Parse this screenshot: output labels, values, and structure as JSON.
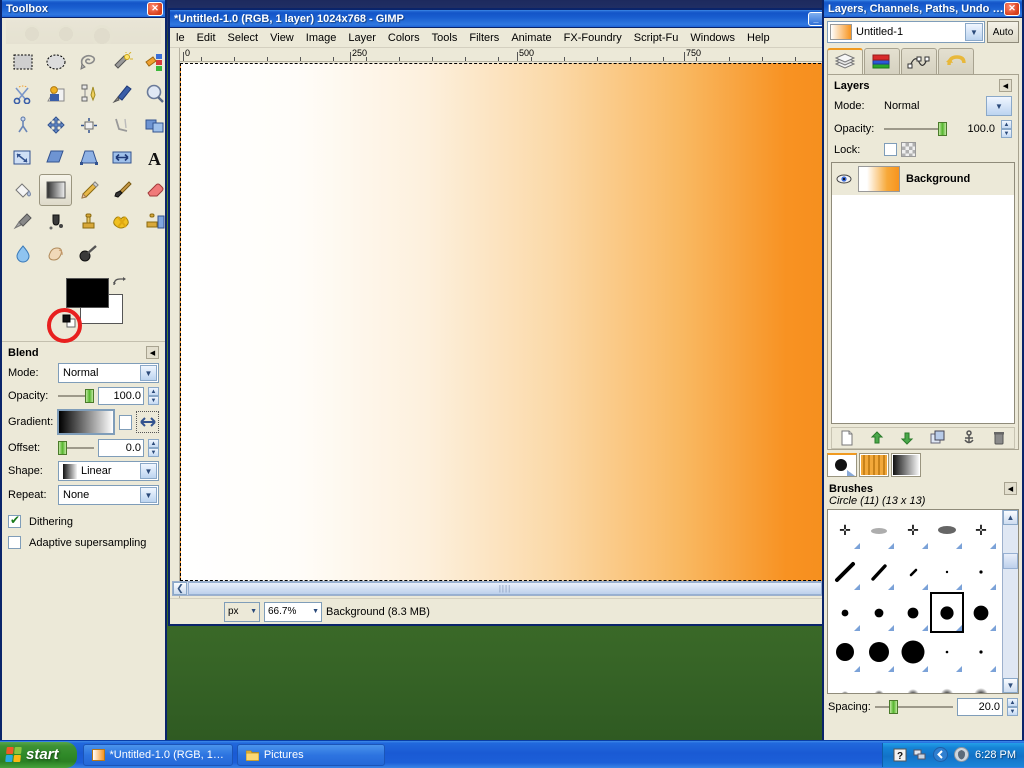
{
  "toolbox": {
    "title": "Toolbox",
    "close_label": "✕",
    "tools": [
      {
        "name": "rect-select-tool",
        "label": "Rectangle Select"
      },
      {
        "name": "ellipse-select-tool",
        "label": "Ellipse Select"
      },
      {
        "name": "free-select-tool",
        "label": "Free Select"
      },
      {
        "name": "fuzzy-select-tool",
        "label": "Fuzzy Select"
      },
      {
        "name": "select-by-color-tool",
        "label": "Select by Color"
      },
      {
        "name": "scissors-select-tool",
        "label": "Scissors Select"
      },
      {
        "name": "foreground-select-tool",
        "label": "Foreground Select"
      },
      {
        "name": "paths-tool",
        "label": "Paths"
      },
      {
        "name": "color-picker-tool",
        "label": "Color Picker"
      },
      {
        "name": "zoom-tool",
        "label": "Zoom"
      },
      {
        "name": "measure-tool",
        "label": "Measure"
      },
      {
        "name": "move-tool",
        "label": "Move"
      },
      {
        "name": "align-tool",
        "label": "Alignment"
      },
      {
        "name": "crop-tool",
        "label": "Crop"
      },
      {
        "name": "rotate-tool",
        "label": "Rotate"
      },
      {
        "name": "scale-tool",
        "label": "Scale"
      },
      {
        "name": "shear-tool",
        "label": "Shear"
      },
      {
        "name": "perspective-tool",
        "label": "Perspective"
      },
      {
        "name": "flip-tool",
        "label": "Flip"
      },
      {
        "name": "text-tool",
        "label": "Text"
      },
      {
        "name": "bucket-fill-tool",
        "label": "Bucket Fill"
      },
      {
        "name": "blend-tool",
        "label": "Blend"
      },
      {
        "name": "pencil-tool",
        "label": "Pencil"
      },
      {
        "name": "paintbrush-tool",
        "label": "Paintbrush"
      },
      {
        "name": "eraser-tool",
        "label": "Eraser"
      },
      {
        "name": "airbrush-tool",
        "label": "Airbrush"
      },
      {
        "name": "ink-tool",
        "label": "Ink"
      },
      {
        "name": "clone-tool",
        "label": "Clone"
      },
      {
        "name": "heal-tool",
        "label": "Heal"
      },
      {
        "name": "perspective-clone-tool",
        "label": "Perspective Clone"
      },
      {
        "name": "blur-sharpen-tool",
        "label": "Blur / Sharpen"
      },
      {
        "name": "smudge-tool",
        "label": "Smudge"
      },
      {
        "name": "dodge-burn-tool",
        "label": "Dodge / Burn"
      }
    ],
    "active_tool_index": 21,
    "foreground_color": "#000000",
    "background_color": "#ffffff"
  },
  "tool_options": {
    "title": "Blend",
    "collapse_label": "◀",
    "mode": {
      "label": "Mode:",
      "value": "Normal"
    },
    "opacity": {
      "label": "Opacity:",
      "value": "100.0"
    },
    "gradient": {
      "label": "Gradient:",
      "reverse_label": "⇔"
    },
    "offset": {
      "label": "Offset:",
      "value": "0.0"
    },
    "shape": {
      "label": "Shape:",
      "value": "Linear"
    },
    "repeat": {
      "label": "Repeat:",
      "value": "None"
    },
    "dithering": {
      "label": "Dithering",
      "checked": true
    },
    "adaptive": {
      "label": "Adaptive supersampling",
      "checked": false
    }
  },
  "image_window": {
    "title": "*Untitled-1.0 (RGB, 1 layer) 1024x768 - GIMP",
    "minimize_label": "_",
    "menu": [
      {
        "name": "file",
        "label": "le"
      },
      {
        "name": "edit",
        "label": "Edit"
      },
      {
        "name": "select",
        "label": "Select"
      },
      {
        "name": "view",
        "label": "View"
      },
      {
        "name": "image",
        "label": "Image"
      },
      {
        "name": "layer",
        "label": "Layer"
      },
      {
        "name": "colors",
        "label": "Colors"
      },
      {
        "name": "tools",
        "label": "Tools"
      },
      {
        "name": "filters",
        "label": "Filters"
      },
      {
        "name": "animate",
        "label": "Animate"
      },
      {
        "name": "fx-foundry",
        "label": "FX-Foundry"
      },
      {
        "name": "script-fu",
        "label": "Script-Fu"
      },
      {
        "name": "windows",
        "label": "Windows"
      },
      {
        "name": "help",
        "label": "Help"
      }
    ],
    "ruler_labels": [
      "0",
      "250",
      "500",
      "750"
    ],
    "statusbar": {
      "unit": "px",
      "zoom": "66.7%",
      "text": "Background (8.3 MB)"
    },
    "canvas_gradient_start": "#ffffff",
    "canvas_gradient_end": "#f7941e"
  },
  "dock": {
    "title": "Layers, Channels, Paths, Undo -...",
    "close_label": "✕",
    "image_name": "Untitled-1",
    "auto_label": "Auto",
    "tabs": [
      {
        "name": "tab-layers",
        "label": "Layers"
      },
      {
        "name": "tab-channels",
        "label": "Channels"
      },
      {
        "name": "tab-paths",
        "label": "Paths"
      },
      {
        "name": "tab-undo",
        "label": "Undo History"
      }
    ],
    "layers_panel": {
      "title": "Layers",
      "collapse_label": "◀",
      "mode": {
        "label": "Mode:",
        "value": "Normal"
      },
      "opacity": {
        "label": "Opacity:",
        "value": "100.0"
      },
      "lock": {
        "label": "Lock:"
      },
      "layers": [
        {
          "name": "Background",
          "visible": true
        }
      ],
      "buttons": [
        {
          "name": "new-layer-button",
          "label": "New Layer"
        },
        {
          "name": "raise-layer-button",
          "label": "Raise Layer"
        },
        {
          "name": "lower-layer-button",
          "label": "Lower Layer"
        },
        {
          "name": "duplicate-layer-button",
          "label": "Duplicate Layer"
        },
        {
          "name": "anchor-layer-button",
          "label": "Anchor Layer"
        },
        {
          "name": "delete-layer-button",
          "label": "Delete Layer"
        }
      ]
    },
    "resource_tabs": [
      {
        "name": "tab-brushes",
        "label": "Brushes"
      },
      {
        "name": "tab-patterns",
        "label": "Patterns"
      },
      {
        "name": "tab-gradients",
        "label": "Gradients"
      }
    ],
    "brushes_panel": {
      "title": "Brushes",
      "collapse_label": "◀",
      "selected_brush": "Circle (11) (13 x 13)",
      "spacing": {
        "label": "Spacing:",
        "value": "20.0"
      }
    }
  },
  "taskbar": {
    "start_label": "start",
    "items": [
      {
        "name": "taskbar-item-gimp",
        "label": "*Untitled-1.0 (RGB, 1…"
      },
      {
        "name": "taskbar-item-pictures",
        "label": "Pictures"
      }
    ],
    "tray": {
      "time": "6:28 PM"
    }
  },
  "annotation": {
    "shape": "red-circle",
    "color": "#e8201f"
  }
}
